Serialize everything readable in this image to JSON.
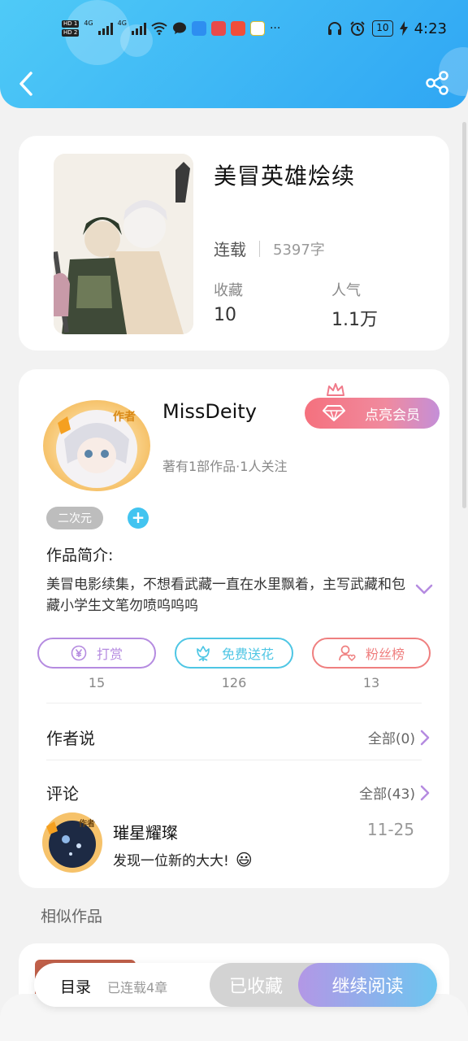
{
  "status_bar": {
    "hd1": "HD 1",
    "hd2": "HD 2",
    "net1": "4G",
    "net2": "4G",
    "more": "···",
    "battery": "10",
    "time": "4:23"
  },
  "header": {
    "back_icon": "back-arrow-icon",
    "share_icon": "share-icon"
  },
  "book": {
    "title": "美冒英雄烩续",
    "status": "连载",
    "words": "5397字",
    "favorites_label": "收藏",
    "favorites_value": "10",
    "popularity_label": "人气",
    "popularity_value": "1.1万"
  },
  "author": {
    "badge": "作者",
    "name": "MissDeity",
    "vip_button": "点亮会员",
    "sub": "著有1部作品·1人关注",
    "tag": "二次元",
    "add_tag": "+"
  },
  "intro": {
    "heading": "作品简介:",
    "text": "美冒电影续集，不想看武藏一直在水里飘着，主写武藏和包藏小学生文笔勿喷呜呜呜"
  },
  "actions": [
    {
      "label": "打赏",
      "count": "15",
      "icon": "yen-icon",
      "color": "#b58be0"
    },
    {
      "label": "免费送花",
      "count": "126",
      "icon": "flower-icon",
      "color": "#4ec6e4"
    },
    {
      "label": "粉丝榜",
      "count": "13",
      "icon": "fans-icon",
      "color": "#ef7f7f"
    }
  ],
  "author_says": {
    "title": "作者说",
    "more": "全部(0)"
  },
  "comments": {
    "title": "评论",
    "more": "全部(43)",
    "items": [
      {
        "badge": "作者",
        "name": "璀星耀璨",
        "date": "11-25",
        "text": "发现一位新的大大!",
        "emoji": "😃"
      }
    ]
  },
  "similar": {
    "title": "相似作品"
  },
  "bottom_bar": {
    "toc": "目录",
    "status": "已连载4章",
    "favorited": "已收藏",
    "continue": "继续阅读"
  },
  "colors": {
    "header_start": "#4fcaf7",
    "header_end": "#2fa6f3",
    "accent_blue": "#42c4f0",
    "vip_pink": "#f5717e"
  }
}
